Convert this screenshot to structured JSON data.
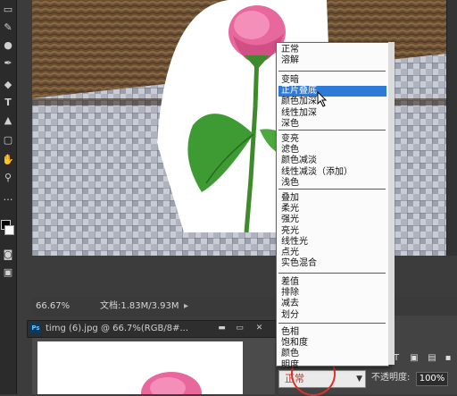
{
  "status_bar": {
    "zoom": "66.67%",
    "doc_info": "文档:1.83M/3.93M"
  },
  "document_tab": {
    "title": "timg (6).jpg @ 66.7%(RGB/8#...",
    "minimize": "▬",
    "maximize": "▭",
    "close": "✕",
    "ps_badge": "Ps"
  },
  "layers_panel": {
    "blend_mode_value": "正常",
    "opacity_label": "不透明度:",
    "opacity_value": "100%"
  },
  "blend_mode_menu": {
    "groups": [
      [
        "正常",
        "溶解"
      ],
      [
        "变暗",
        "正片叠底",
        "颜色加深",
        "线性加深",
        "深色"
      ],
      [
        "变亮",
        "滤色",
        "颜色减淡",
        "线性减淡（添加）",
        "浅色"
      ],
      [
        "叠加",
        "柔光",
        "强光",
        "亮光",
        "线性光",
        "点光",
        "实色混合"
      ],
      [
        "差值",
        "排除",
        "减去",
        "划分"
      ],
      [
        "色相",
        "饱和度",
        "颜色",
        "明度"
      ]
    ],
    "selected": "正片叠底"
  },
  "colors": {
    "menu_highlight": "#2f7ad6",
    "annotation_circle": "#e0302a"
  }
}
